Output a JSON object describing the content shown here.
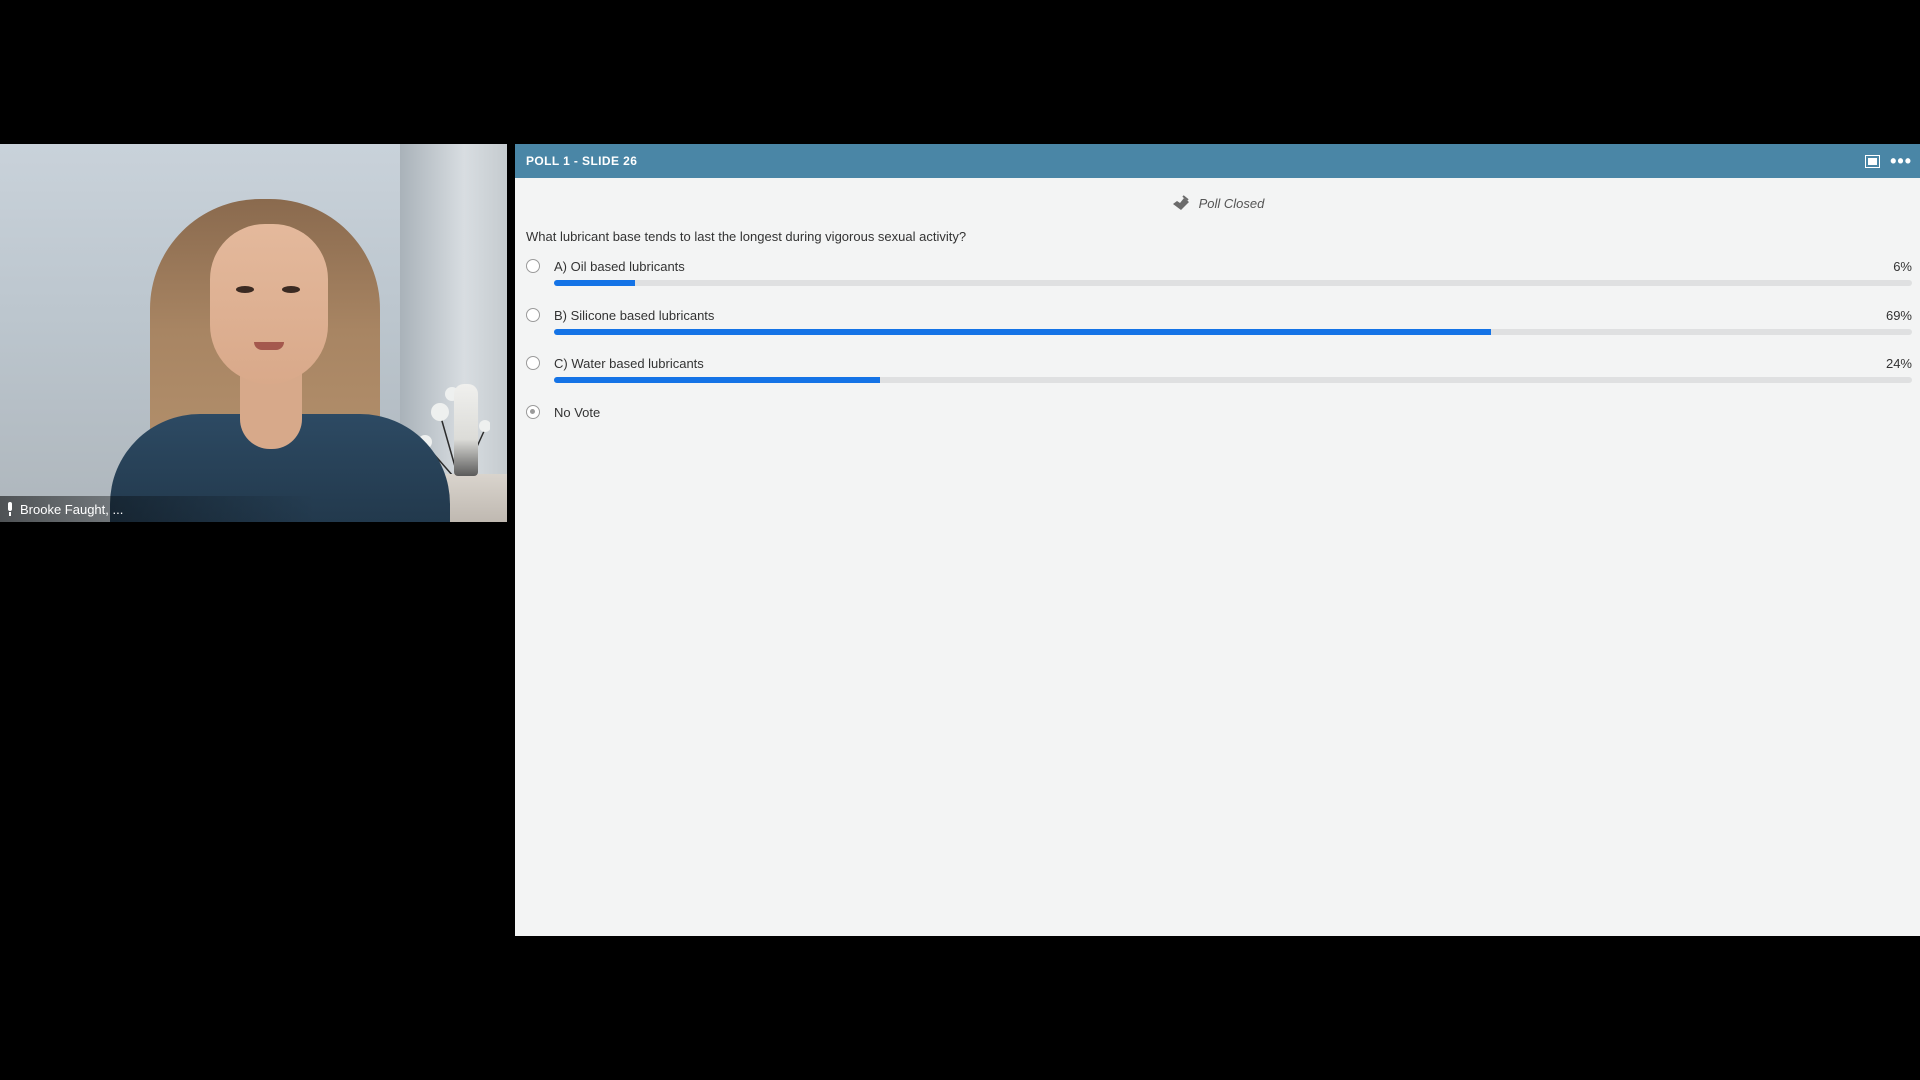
{
  "video": {
    "participant_name": "Brooke Faught, ..."
  },
  "pod": {
    "title": "POLL 1 - SLIDE 26",
    "status": "Poll Closed",
    "question": "What lubricant base tends to last the longest during vigorous sexual activity?",
    "answers": [
      {
        "label": "A) Oil based lubricants",
        "percent_text": "6%",
        "percent": 6
      },
      {
        "label": "B) Silicone based lubricants",
        "percent_text": "69%",
        "percent": 69
      },
      {
        "label": "C) Water based lubricants",
        "percent_text": "24%",
        "percent": 24
      }
    ],
    "no_vote_label": "No Vote"
  },
  "colors": {
    "header": "#4a86a6",
    "bar_fill": "#1473e6",
    "bar_track": "#dfe0e1",
    "pod_background": "#f3f4f4"
  },
  "icons": {
    "status": "checkmark-ballot-icon",
    "fullscreen": "fullscreen-icon",
    "menu": "more-options-icon",
    "mic": "microphone-icon"
  }
}
